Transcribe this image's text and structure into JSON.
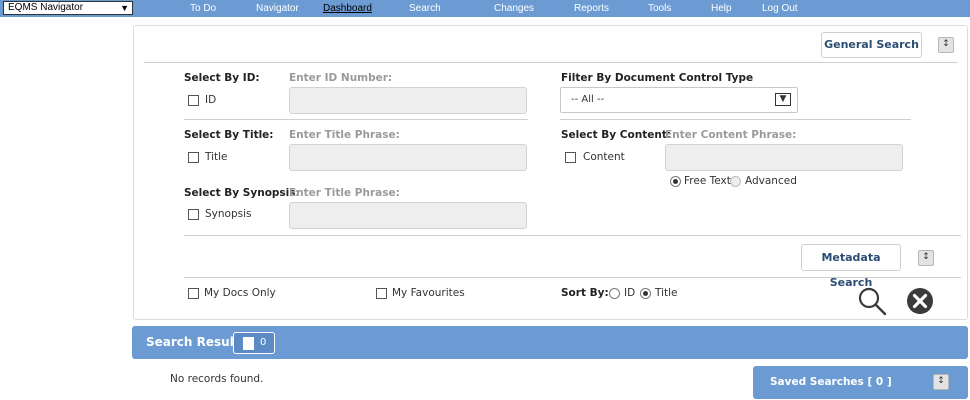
{
  "nav": {
    "selector_value": "EQMS Navigator",
    "items": [
      "To Do",
      "Navigator",
      "Dashboard",
      "Search",
      "Changes",
      "Reports",
      "Tools",
      "Help",
      "Log Out"
    ]
  },
  "panel": {
    "general_search_label": "General Search",
    "select_by_id": {
      "label": "Select By ID:",
      "checkbox": "ID",
      "field_label": "Enter ID Number:"
    },
    "select_by_title": {
      "label": "Select By Title:",
      "checkbox": "Title",
      "field_label": "Enter Title Phrase:"
    },
    "select_by_synopsis": {
      "label": "Select By Synopsis:",
      "checkbox": "Synopsis",
      "field_label": "Enter Title Phrase:"
    },
    "filter_doc_control": {
      "label": "Filter By Document Control Type",
      "selected": "-- All --"
    },
    "select_by_content": {
      "label": "Select By Content:",
      "checkbox": "Content",
      "field_label": "Enter Content Phrase:"
    },
    "content_mode": {
      "options": [
        "Free Text",
        "Advanced"
      ],
      "selected": "Free Text"
    },
    "metadata_search_label": "Metadata Search",
    "my_docs_only": "My Docs Only",
    "my_favourites": "My Favourites",
    "sort_by": {
      "label": "Sort By:",
      "options": [
        "ID",
        "Title"
      ],
      "selected": "Title"
    }
  },
  "result": {
    "title": "Search Result",
    "count": "0",
    "empty_message": "No records found."
  },
  "saved_searches": {
    "label": "Saved Searches [ 0 ]"
  },
  "colors": {
    "nav_bg": "#6b9bd2",
    "link_text": "#2b4c73"
  }
}
